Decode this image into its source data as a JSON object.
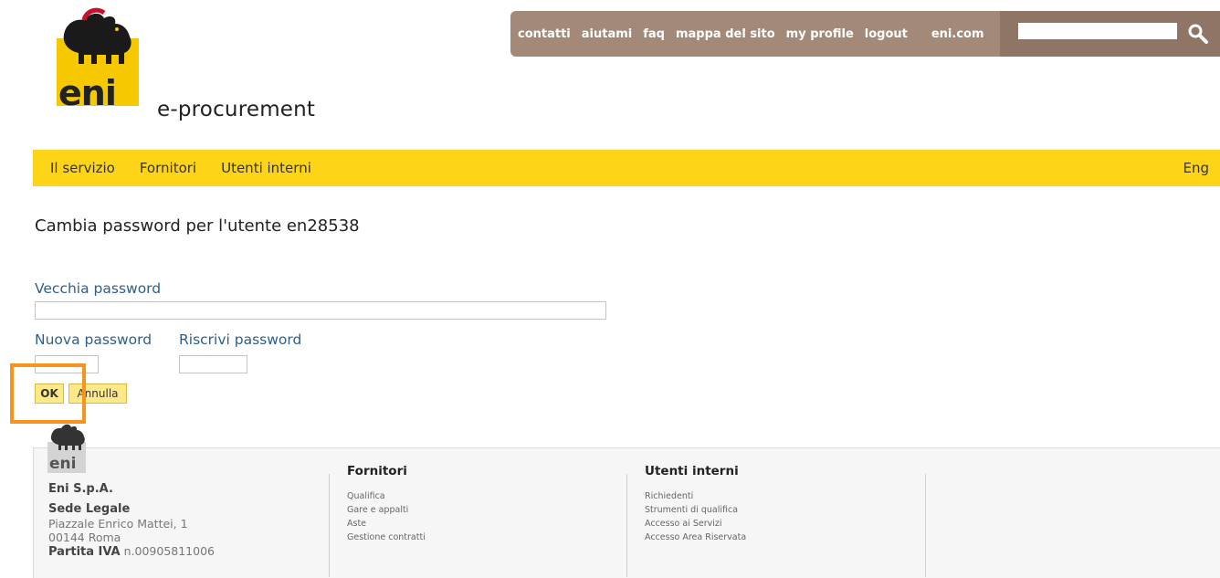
{
  "brand": {
    "logo_text": "eni",
    "app_title": "e-procurement"
  },
  "topbar": {
    "links": [
      "contatti",
      "aiutami",
      "faq",
      "mappa del sito",
      "my profile",
      "logout",
      "eni.com"
    ],
    "search_value": "",
    "search_icon": "search-icon"
  },
  "nav": {
    "items": [
      "Il servizio",
      "Fornitori",
      "Utenti interni"
    ],
    "lang": "Eng"
  },
  "form": {
    "heading": "Cambia password per l'utente en28538",
    "old_label": "Vecchia password",
    "new_label": "Nuova password",
    "repeat_label": "Riscrivi password",
    "ok_label": "OK",
    "cancel_label": "Annulla"
  },
  "footer": {
    "logo_text": "eni",
    "company": "Eni S.p.A.",
    "seat_heading": "Sede Legale",
    "address_line1": "Piazzale Enrico Mattei, 1",
    "address_line2": "00144 Roma",
    "vat_label": "Partita IVA",
    "vat_value": "n.00905811006",
    "col1": {
      "heading": "Fornitori",
      "links": [
        "Qualifica",
        "Gare e appalti",
        "Aste",
        "Gestione contratti"
      ]
    },
    "col2": {
      "heading": "Utenti interni",
      "links": [
        "Richiedenti",
        "Strumenti di qualifica",
        "Accesso ai Servizi",
        "Accesso Area Riservata"
      ]
    }
  },
  "colors": {
    "nav_yellow": "#fdd418",
    "topbar_brown": "#a38a78",
    "highlight_orange": "#f7941d",
    "label_blue": "#2e5e8c"
  }
}
